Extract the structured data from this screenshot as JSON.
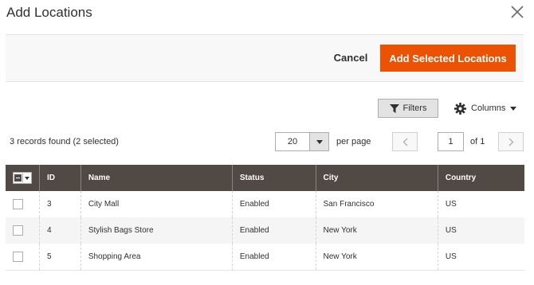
{
  "modal": {
    "title": "Add Locations"
  },
  "actions": {
    "cancel_label": "Cancel",
    "add_label": "Add Selected Locations"
  },
  "controls": {
    "filters_label": "Filters",
    "columns_label": "Columns"
  },
  "grid_info": {
    "records": "3 records found (2 selected)",
    "per_page_value": "20",
    "per_page_label": "per page",
    "page_value": "1",
    "page_of": "of 1"
  },
  "table": {
    "headers": [
      "ID",
      "Name",
      "Status",
      "City",
      "Country"
    ],
    "rows": [
      {
        "id": "3",
        "name": "City Mall",
        "status": "Enabled",
        "city": "San Francisco",
        "country": "US"
      },
      {
        "id": "4",
        "name": "Stylish Bags Store",
        "status": "Enabled",
        "city": "New York",
        "country": "US"
      },
      {
        "id": "5",
        "name": "Shopping Area",
        "status": "Enabled",
        "city": "New York",
        "country": "US"
      }
    ]
  },
  "colors": {
    "accent": "#eb5202",
    "header_bg": "#514943",
    "toolbar_bg": "#f8f8f8"
  },
  "icons": [
    "close-icon",
    "filter-icon",
    "gear-icon",
    "caret-down-icon",
    "chevron-left-icon",
    "chevron-right-icon"
  ]
}
